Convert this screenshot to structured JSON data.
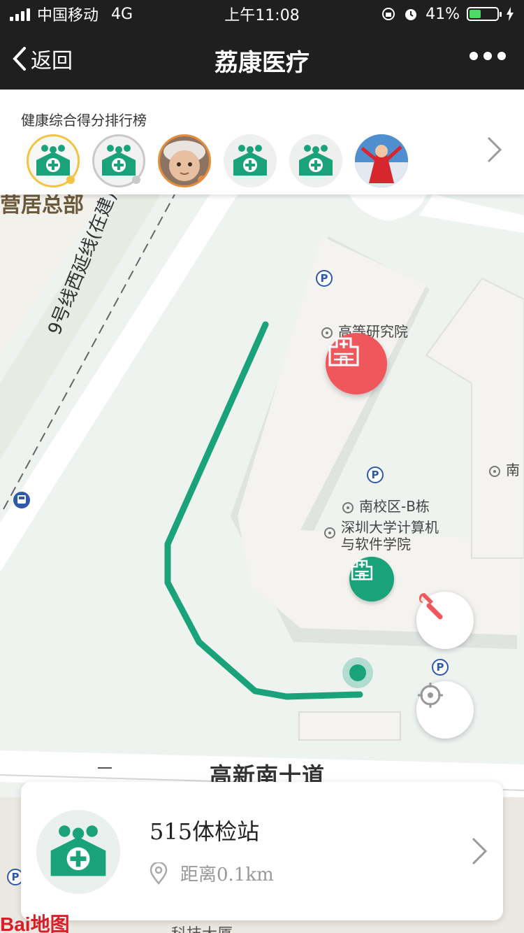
{
  "status": {
    "carrier": "中国移动",
    "network": "4G",
    "time": "上午11:08",
    "battery": "41%",
    "battery_level": 0.41
  },
  "nav": {
    "back_label": "返回",
    "title": "荔康医疗",
    "more_icon": "more-dots-icon"
  },
  "ranking": {
    "title": "健康综合得分排行榜",
    "avatars": [
      {
        "type": "clinic-logo",
        "medal": "gold"
      },
      {
        "type": "clinic-logo",
        "medal": "silver"
      },
      {
        "type": "photo-baby",
        "medal": "bronze"
      },
      {
        "type": "clinic-logo"
      },
      {
        "type": "clinic-logo"
      },
      {
        "type": "photo-person"
      }
    ]
  },
  "map": {
    "line_label": "9号线西延线(在建)",
    "top_left_label": "营居总部",
    "pois": {
      "institute": "高等研究院",
      "south_campus": "南校区-B栋",
      "cs_college_line1": "深圳大学计算机",
      "cs_college_line2": "与软件学院",
      "south_partial": "南"
    },
    "road_name": "高新南十道",
    "parking_symbol": "P",
    "bottom_partial": "科技大厦"
  },
  "card": {
    "name": "515体检站",
    "distance": "距离0.1km"
  },
  "watermark": "Bai地图",
  "colors": {
    "brand_green": "#1aa37a",
    "marker_red": "#f0575c",
    "topbar": "#1f1f1f"
  }
}
